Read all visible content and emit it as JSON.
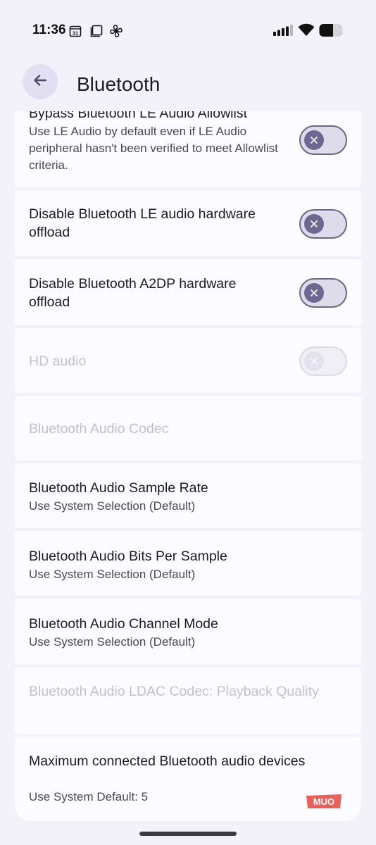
{
  "status_bar": {
    "time": "11:36",
    "calendar_day": "31",
    "icons": [
      "calendar-icon",
      "screenshot-icon",
      "fan-icon",
      "signal-icon",
      "wifi-icon",
      "battery-icon"
    ]
  },
  "app_bar": {
    "title": "Bluetooth",
    "back_icon": "arrow-back-icon"
  },
  "items": [
    {
      "title": "Bypass Bluetooth LE Audio Allowlist",
      "summary": "Use LE Audio by default even if LE Audio peripheral hasn't been verified to meet Allowlist criteria.",
      "toggle": "off",
      "enabled": true
    },
    {
      "title": "Disable Bluetooth LE audio hardware offload",
      "toggle": "off",
      "enabled": true
    },
    {
      "title": "Disable Bluetooth A2DP hardware offload",
      "toggle": "off",
      "enabled": true
    },
    {
      "title": "HD audio",
      "toggle": "off",
      "enabled": false
    },
    {
      "title": "Bluetooth Audio Codec",
      "enabled": false
    },
    {
      "title": "Bluetooth Audio Sample Rate",
      "summary": "Use System Selection (Default)",
      "enabled": true
    },
    {
      "title": "Bluetooth Audio Bits Per Sample",
      "summary": "Use System Selection (Default)",
      "enabled": true
    },
    {
      "title": "Bluetooth Audio Channel Mode",
      "summary": "Use System Selection (Default)",
      "enabled": true
    },
    {
      "title": "Bluetooth Audio LDAC Codec: Playback Quality",
      "enabled": false
    },
    {
      "title": "Maximum connected Bluetooth audio devices",
      "summary": "Use System Default: 5",
      "enabled": true
    }
  ],
  "watermark": {
    "text": "MUO"
  },
  "colors": {
    "background": "#f3f1fa",
    "card": "#fcfbff",
    "switch_thumb": "#6d6890",
    "watermark": "#e8605a"
  }
}
